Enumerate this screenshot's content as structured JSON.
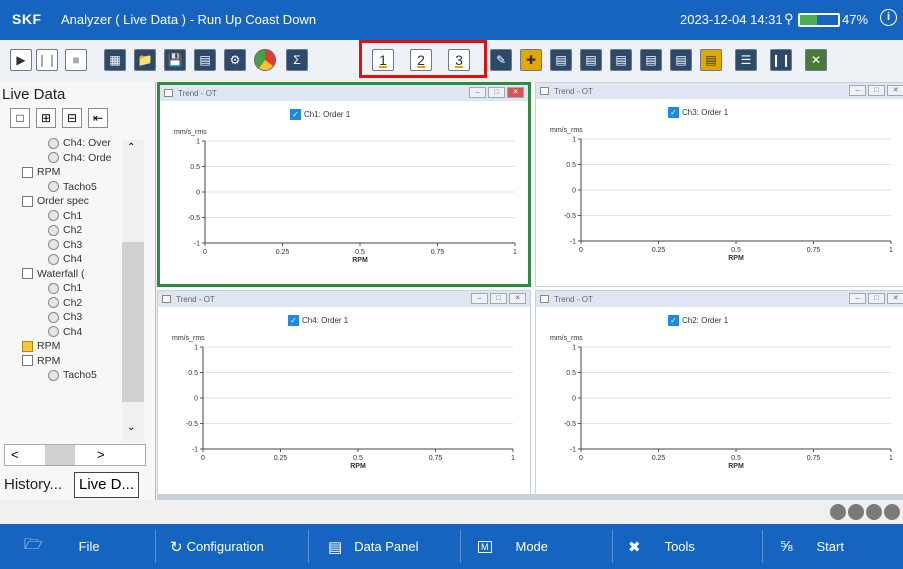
{
  "app": {
    "brand": "SKF",
    "title": "Analyzer ( Live Data ) - Run Up Coast Down",
    "datetime": "2023-12-04 14:31",
    "battery": "47%"
  },
  "toolbar": {
    "icons": [
      "play-icon",
      "pause-icon",
      "stop-icon",
      "record-icon",
      "open-folder-icon",
      "save-icon",
      "document-icon",
      "gear-icon",
      "pie-chart-icon",
      "sigma-icon",
      "layout-1",
      "layout-2",
      "layout-3",
      "cursor-icon",
      "add-icon",
      "spectrum-icon",
      "spectrum-2-icon",
      "bars-icon",
      "bars-2-icon",
      "plot-icon",
      "panel-icon",
      "list-icon",
      "columns-icon",
      "close-panel-icon"
    ],
    "layout_buttons": [
      "1",
      "2",
      "3"
    ]
  },
  "sidebar": {
    "title": "Live Data",
    "items": [
      {
        "label": "Ch4: Over",
        "icon": "ch"
      },
      {
        "label": "Ch4: Orde",
        "icon": "ch"
      },
      {
        "label": "RPM",
        "icon": "wv"
      },
      {
        "label": "Tacho5",
        "icon": "ch"
      },
      {
        "label": "Order spec",
        "icon": "wv"
      },
      {
        "label": "Ch1",
        "icon": "ch"
      },
      {
        "label": "Ch2",
        "icon": "ch"
      },
      {
        "label": "Ch3",
        "icon": "ch"
      },
      {
        "label": "Ch4",
        "icon": "ch"
      },
      {
        "label": "Waterfall (",
        "icon": "wv"
      },
      {
        "label": "Ch1",
        "icon": "ch"
      },
      {
        "label": "Ch2",
        "icon": "ch"
      },
      {
        "label": "Ch3",
        "icon": "ch"
      },
      {
        "label": "Ch4",
        "icon": "ch"
      },
      {
        "label": "RPM",
        "icon": "fd"
      },
      {
        "label": "RPM",
        "icon": "wv"
      },
      {
        "label": "Tacho5",
        "icon": "ch"
      }
    ],
    "tabs": {
      "history": "History...",
      "live": "Live D..."
    },
    "scroll_left": "<",
    "scroll_right": ">"
  },
  "panels": [
    {
      "title": "Trend - OT",
      "legend": "Ch1: Order 1",
      "ylabel": "mm/s_rms",
      "xlabel": "RPM",
      "yticks": [
        "1",
        "0.5",
        "0",
        "-0.5",
        "-1"
      ],
      "xticks": [
        "0",
        "0.25",
        "0.5",
        "0.75",
        "1"
      ]
    },
    {
      "title": "Trend - OT",
      "legend": "Ch3: Order 1",
      "ylabel": "mm/s_rms",
      "xlabel": "RPM",
      "yticks": [
        "1",
        "0.5",
        "0",
        "-0.5",
        "-1"
      ],
      "xticks": [
        "0",
        "0.25",
        "0.5",
        "0.75",
        "1"
      ]
    },
    {
      "title": "Trend - OT",
      "legend": "Ch4: Order 1",
      "ylabel": "mm/s_rms",
      "xlabel": "RPM",
      "yticks": [
        "1",
        "0.5",
        "0",
        "-0.5",
        "-1"
      ],
      "xticks": [
        "0",
        "0.25",
        "0.5",
        "0.75",
        "1"
      ]
    },
    {
      "title": "Trend - OT",
      "legend": "Ch2: Order 1",
      "ylabel": "mm/s_rms",
      "xlabel": "RPM",
      "yticks": [
        "1",
        "0.5",
        "0",
        "-0.5",
        "-1"
      ],
      "xticks": [
        "0",
        "0.25",
        "0.5",
        "0.75",
        "1"
      ]
    }
  ],
  "bottombar": {
    "file": "File",
    "configuration": "Configuration",
    "data_panel": "Data Panel",
    "mode": "Mode",
    "tools": "Tools",
    "start": "Start"
  },
  "colors": {
    "accent": "#1565c0",
    "active_panel": "#2e8b3d",
    "highlight": "#e01010"
  }
}
